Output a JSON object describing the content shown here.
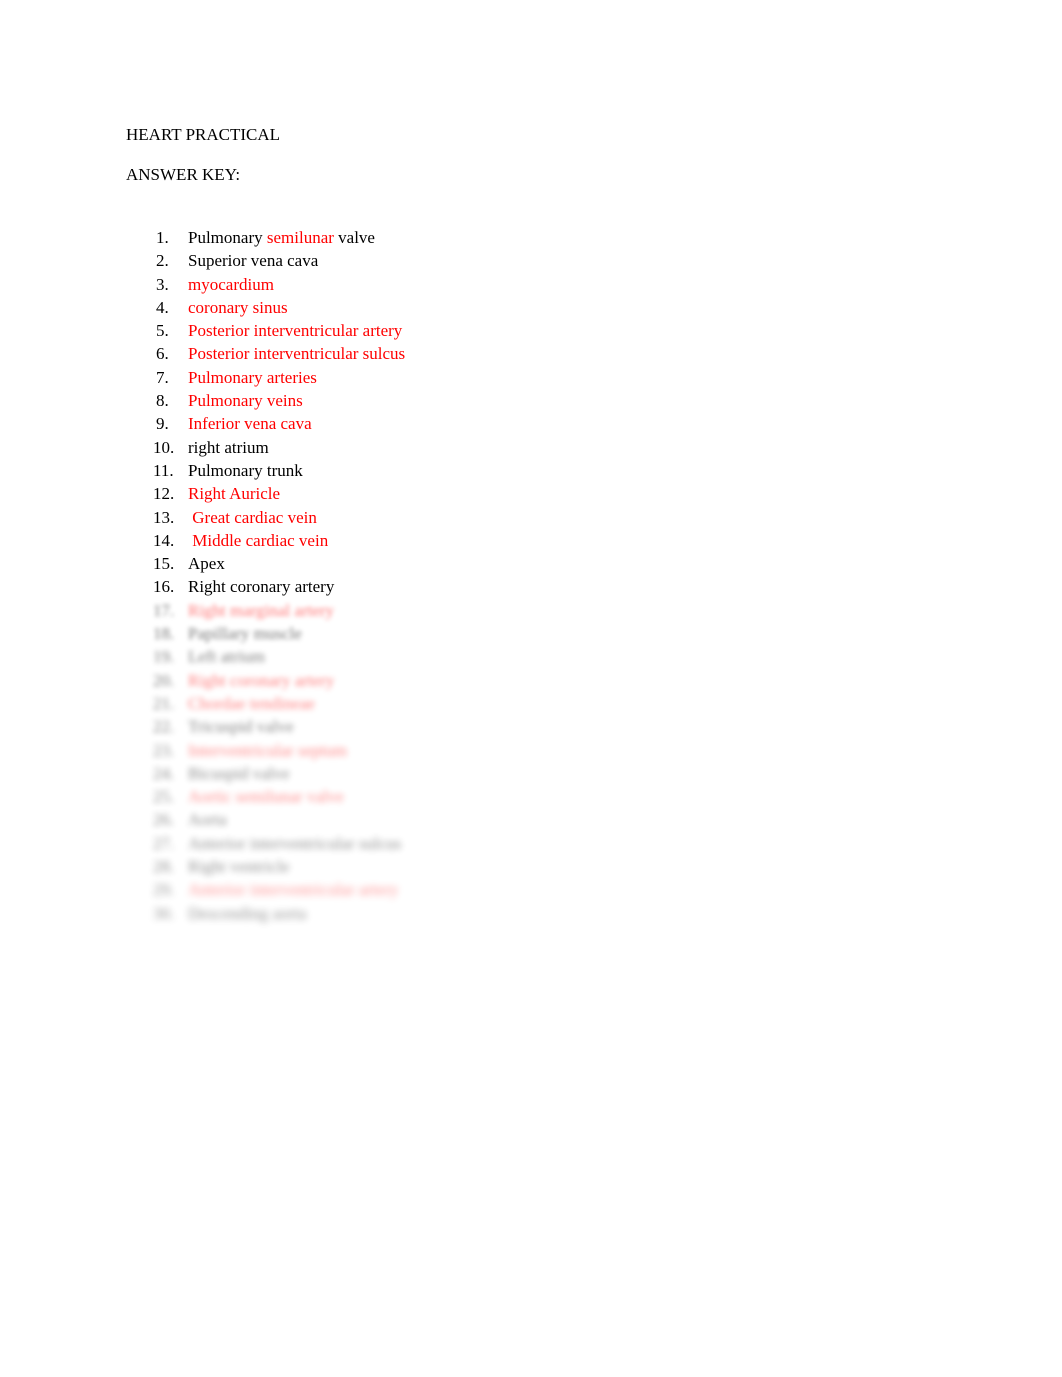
{
  "document": {
    "title_line": "HEART PRACTICAL",
    "subtitle_line": "ANSWER KEY:",
    "text_color": "#000000",
    "accent_color": "#FF0000",
    "background_color": "#FFFFFF"
  },
  "answer_list": {
    "items": [
      {
        "number": "1.",
        "legible": true,
        "segments": [
          {
            "text": "Pulmonary ",
            "color": "black"
          },
          {
            "text": "semilunar",
            "color": "red"
          },
          {
            "text": " valve",
            "color": "black"
          }
        ]
      },
      {
        "number": "2.",
        "legible": true,
        "segments": [
          {
            "text": "Superior vena cava",
            "color": "black"
          }
        ]
      },
      {
        "number": "3.",
        "legible": true,
        "segments": [
          {
            "text": "myocardium",
            "color": "red"
          }
        ]
      },
      {
        "number": "4.",
        "legible": true,
        "segments": [
          {
            "text": "coronary sinus",
            "color": "red"
          }
        ]
      },
      {
        "number": "5.",
        "legible": true,
        "segments": [
          {
            "text": "Posterior interventricular artery",
            "color": "red"
          }
        ]
      },
      {
        "number": "6.",
        "legible": true,
        "segments": [
          {
            "text": "Posterior interventricular sulcus",
            "color": "red"
          }
        ]
      },
      {
        "number": "7.",
        "legible": true,
        "segments": [
          {
            "text": "Pulmonary arteries",
            "color": "red"
          }
        ]
      },
      {
        "number": "8.",
        "legible": true,
        "segments": [
          {
            "text": "Pulmonary veins",
            "color": "red"
          }
        ]
      },
      {
        "number": "9.",
        "legible": true,
        "segments": [
          {
            "text": "Inferior vena cava",
            "color": "red"
          }
        ]
      },
      {
        "number": "10.",
        "legible": true,
        "segments": [
          {
            "text": "right atrium",
            "color": "black"
          }
        ]
      },
      {
        "number": "11.",
        "legible": true,
        "segments": [
          {
            "text": "Pulmonary trunk",
            "color": "black"
          }
        ]
      },
      {
        "number": "12.",
        "legible": true,
        "segments": [
          {
            "text": "Right Auricle",
            "color": "red"
          }
        ]
      },
      {
        "number": "13.",
        "legible": true,
        "segments": [
          {
            "text": " Great cardiac vein",
            "color": "red"
          }
        ]
      },
      {
        "number": "14.",
        "legible": true,
        "segments": [
          {
            "text": " Middle cardiac vein",
            "color": "red"
          }
        ]
      },
      {
        "number": "15.",
        "legible": true,
        "segments": [
          {
            "text": "Apex",
            "color": "black"
          }
        ]
      },
      {
        "number": "16.",
        "legible": true,
        "segments": [
          {
            "text": "Right coronary artery",
            "color": "black"
          }
        ]
      },
      {
        "number": "17.",
        "legible": false,
        "blur_level": 1,
        "segments": [
          {
            "text": "Right marginal artery",
            "color": "red"
          }
        ]
      },
      {
        "number": "18.",
        "legible": false,
        "blur_level": 1,
        "segments": [
          {
            "text": "Papillary muscle",
            "color": "black"
          }
        ]
      },
      {
        "number": "19.",
        "legible": false,
        "blur_level": 2,
        "segments": [
          {
            "text": "Left atrium",
            "color": "black"
          }
        ]
      },
      {
        "number": "20.",
        "legible": false,
        "blur_level": 2,
        "segments": [
          {
            "text": "Right coronary artery",
            "color": "red"
          }
        ]
      },
      {
        "number": "21.",
        "legible": false,
        "blur_level": 3,
        "segments": [
          {
            "text": "Chordae tendineae",
            "color": "red"
          }
        ]
      },
      {
        "number": "22.",
        "legible": false,
        "blur_level": 3,
        "segments": [
          {
            "text": "Tricuspid valve",
            "color": "black"
          }
        ]
      },
      {
        "number": "23.",
        "legible": false,
        "blur_level": 4,
        "segments": [
          {
            "text": "Interventricular septum",
            "color": "red"
          }
        ]
      },
      {
        "number": "24.",
        "legible": false,
        "blur_level": 4,
        "segments": [
          {
            "text": "Bicuspid valve",
            "color": "black"
          }
        ]
      },
      {
        "number": "25.",
        "legible": false,
        "blur_level": 5,
        "segments": [
          {
            "text": "Aortic semilunar valve",
            "color": "red"
          }
        ]
      },
      {
        "number": "26.",
        "legible": false,
        "blur_level": 5,
        "segments": [
          {
            "text": "Aorta",
            "color": "black"
          }
        ]
      },
      {
        "number": "27.",
        "legible": false,
        "blur_level": 6,
        "segments": [
          {
            "text": "Anterior interventricular sulcus",
            "color": "black"
          }
        ]
      },
      {
        "number": "28.",
        "legible": false,
        "blur_level": 6,
        "segments": [
          {
            "text": "Right ventricle",
            "color": "black"
          }
        ]
      },
      {
        "number": "29.",
        "legible": false,
        "blur_level": 7,
        "segments": [
          {
            "text": "Anterior interventricular artery",
            "color": "red"
          }
        ]
      },
      {
        "number": "30.",
        "legible": false,
        "blur_level": 7,
        "segments": [
          {
            "text": "Descending aorta",
            "color": "black"
          }
        ]
      }
    ]
  }
}
